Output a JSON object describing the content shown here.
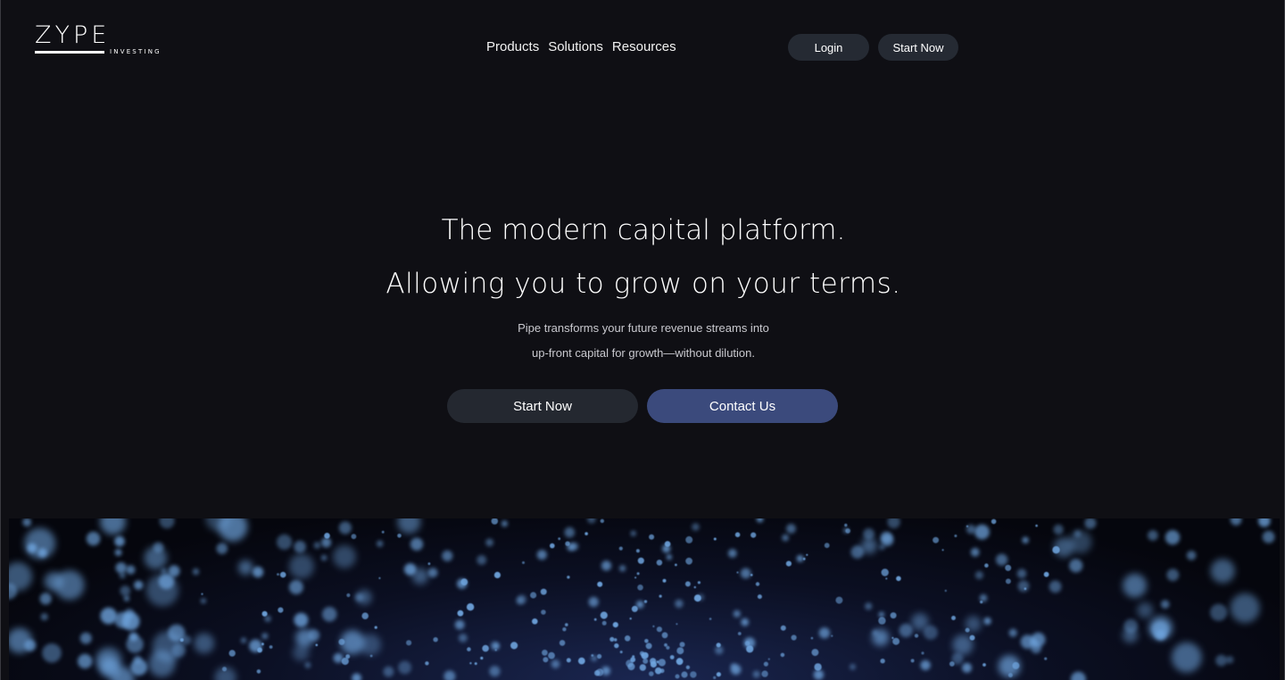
{
  "header": {
    "logo": {
      "word": "ZYPE",
      "sub": "INVESTING"
    },
    "nav": [
      {
        "label": "Products"
      },
      {
        "label": "Solutions"
      },
      {
        "label": "Resources"
      }
    ],
    "login_label": "Login",
    "start_label": "Start Now"
  },
  "hero": {
    "title_line1": "The modern capital platform.",
    "title_line2": "Allowing you to grow on your terms.",
    "subtitle_line1": "Pipe transforms your future revenue streams into",
    "subtitle_line2": "up-front capital for growth—without dilution.",
    "start_label": "Start Now",
    "contact_label": "Contact Us"
  },
  "colors": {
    "background": "#0f0f14",
    "button_dark": "#242830",
    "button_accent": "#3b4a7c",
    "particle": "#6fa6e0"
  }
}
